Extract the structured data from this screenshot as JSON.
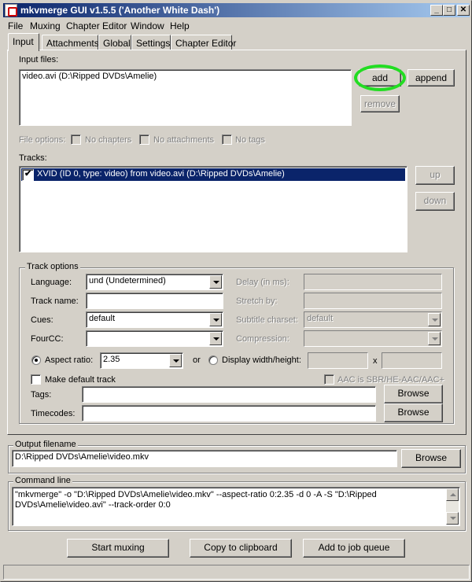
{
  "window": {
    "title": "mkvmerge GUI v1.5.5 ('Another White Dash')",
    "controls": [
      "_",
      "□",
      "✕"
    ]
  },
  "menu": [
    {
      "label": "File"
    },
    {
      "label": "Muxing"
    },
    {
      "label": "Chapter Editor"
    },
    {
      "label": "Window"
    },
    {
      "label": "Help"
    }
  ],
  "tabs": [
    {
      "label": "Input",
      "active": true
    },
    {
      "label": "Attachments"
    },
    {
      "label": "Global"
    },
    {
      "label": "Settings"
    },
    {
      "label": "Chapter Editor"
    }
  ],
  "input_files": {
    "label": "Input files:",
    "items": [
      "video.avi (D:\\Ripped DVDs\\Amelie)"
    ],
    "add_label": "add",
    "append_label": "append",
    "remove_label": "remove",
    "highlight_color": "#22dd22"
  },
  "file_options": {
    "label": "File options:",
    "no_chapters": "No chapters",
    "no_attachments": "No attachments",
    "no_tags": "No tags"
  },
  "tracks": {
    "label": "Tracks:",
    "items": [
      {
        "text": "XVID (ID 0, type: video) from video.avi (D:\\Ripped DVDs\\Amelie)",
        "checked": true
      }
    ],
    "up_label": "up",
    "down_label": "down",
    "selection_color": "#0a246a"
  },
  "track_options": {
    "title": "Track options",
    "language_label": "Language:",
    "language_value": "und (Undetermined)",
    "track_name_label": "Track name:",
    "track_name_value": "",
    "cues_label": "Cues:",
    "cues_value": "default",
    "fourcc_label": "FourCC:",
    "fourcc_value": "",
    "delay_label": "Delay (in ms):",
    "stretch_label": "Stretch by:",
    "subtitle_charset_label": "Subtitle charset:",
    "subtitle_charset_value": "default",
    "compression_label": "Compression:",
    "aspect_ratio_label": "Aspect ratio:",
    "aspect_ratio_value": "2.35",
    "or_label": "or",
    "display_wh_label": "Display width/height:",
    "x_label": "x",
    "make_default_label": "Make default track",
    "aac_label": "AAC is SBR/HE-AAC/AAC+",
    "tags_label": "Tags:",
    "timecodes_label": "Timecodes:",
    "browse_label": "Browse"
  },
  "output": {
    "title": "Output filename",
    "value": "D:\\Ripped DVDs\\Amelie\\video.mkv",
    "browse_label": "Browse"
  },
  "command_line": {
    "title": "Command line",
    "text": "\"mkvmerge\" -o \"D:\\Ripped DVDs\\Amelie\\video.mkv\"  --aspect-ratio 0:2.35 -d 0 -A -S \"D:\\Ripped DVDs\\Amelie\\video.avi\" --track-order 0:0"
  },
  "actions": {
    "start_muxing": "Start muxing",
    "copy_clipboard": "Copy to clipboard",
    "add_job_queue": "Add to job queue"
  }
}
